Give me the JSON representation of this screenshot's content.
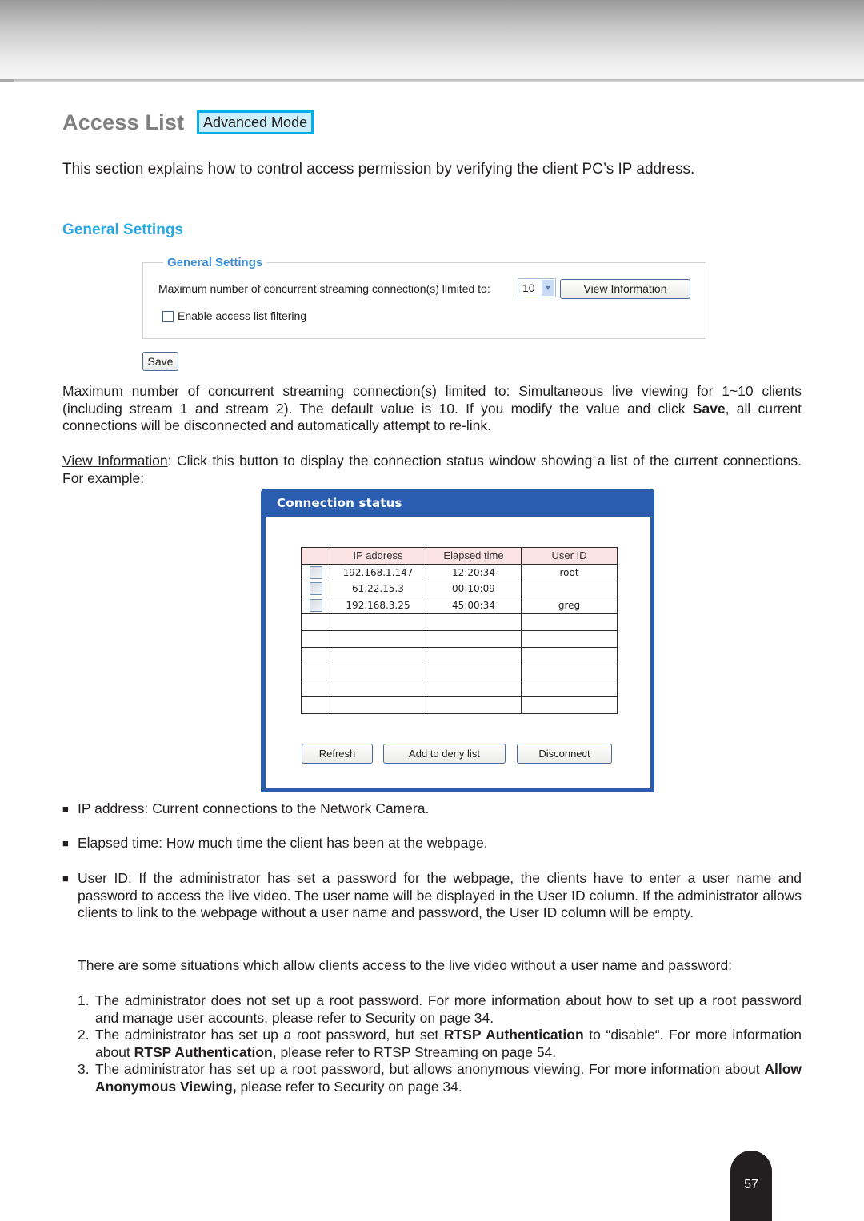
{
  "page": {
    "title": "Access List",
    "mode_badge": "Advanced Mode",
    "intro": "This section explains how to control access permission by verifying the client PC’s IP address.",
    "section_heading": "General Settings",
    "page_number": "57"
  },
  "general_settings_panel": {
    "legend": "General Settings",
    "max_connections_label": "Maximum number of concurrent streaming connection(s) limited to:",
    "max_connections_value": "10",
    "view_information_button": "View Information",
    "enable_filtering_label": "Enable access list filtering",
    "enable_filtering_checked": false,
    "save_button": "Save"
  },
  "descriptions": {
    "max_conn": {
      "term": "Maximum number of concurrent streaming connection(s) limited to",
      "text_before_bold": ": Simultaneous live viewing for 1~10 clients (including stream 1 and stream 2). The default value is 10. If you modify the value and click ",
      "bold": "Save",
      "text_after_bold": ", all current connections will be disconnected and automatically attempt to re-link."
    },
    "view_info": {
      "term": "View Information",
      "text": ": Click this button to display the connection status window showing a list of the current connections. For example:"
    }
  },
  "connection_status": {
    "title": "Connection status",
    "columns": [
      "",
      "IP address",
      "Elapsed time",
      "User ID"
    ],
    "rows": [
      {
        "ip": "192.168.1.147",
        "elapsed": "12:20:34",
        "user": "root"
      },
      {
        "ip": "61.22.15.3",
        "elapsed": "00:10:09",
        "user": ""
      },
      {
        "ip": "192.168.3.25",
        "elapsed": "45:00:34",
        "user": "greg"
      }
    ],
    "empty_rows": 6,
    "buttons": {
      "refresh": "Refresh",
      "add_to_deny": "Add to deny list",
      "disconnect": "Disconnect"
    }
  },
  "bullets": {
    "mark": "■",
    "ip": "IP address: Current connections to the Network Camera.",
    "elapsed": "Elapsed time: How much time the client has been at the webpage.",
    "user_id": "User ID: If the administrator has set a password for the webpage, the clients have to enter a user name and password to access the live video. The user name will be displayed in the User ID column. If  the administrator allows clients to link to the webpage without a user name and password, the User ID column will be empty."
  },
  "situations": {
    "intro": "There are some situations which allow clients access to the live video without a user name and password:",
    "items": [
      {
        "num": "1.",
        "pre": "The administrator does not set up a root password. For more information about how to set up a root password and manage user accounts, please refer to Security on page 34.",
        "bold1": "",
        "mid": "",
        "bold2": "",
        "post": ""
      },
      {
        "num": "2.",
        "pre": "The administrator has set up a root password, but set ",
        "bold1": "RTSP Authentication",
        "mid": " to “disable“. For more information about ",
        "bold2": "RTSP Authentication",
        "post": ", please refer to RTSP Streaming on page 54."
      },
      {
        "num": "3.",
        "pre": "The administrator has set up a root password, but allows anonymous viewing. For more information about ",
        "bold1": "Allow Anonymous Viewing,",
        "mid": " please refer to Security on page 34.",
        "bold2": "",
        "post": ""
      }
    ]
  },
  "colors": {
    "accent_blue": "#29a8e0",
    "badge_border": "#00aeef",
    "window_blue": "#2a5db0",
    "table_header_bg": "#fde4e4"
  }
}
